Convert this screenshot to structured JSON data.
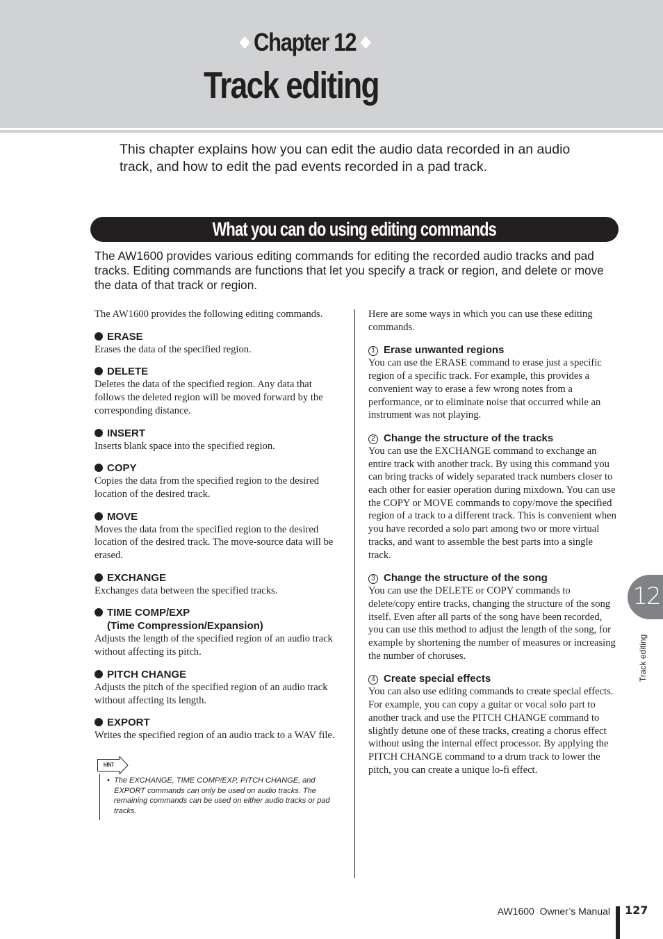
{
  "header": {
    "chapter_label": "Chapter 12",
    "chapter_title": "Track editing",
    "diamond_glyph": "◆"
  },
  "intro": "This chapter explains how you can edit the audio data recorded in an audio track, and how to edit the pad events recorded in a pad track.",
  "section": {
    "title": "What you can do using editing commands",
    "lead": "The AW1600 provides various editing commands for editing the recorded audio tracks and pad tracks. Editing commands are functions that let you specify a track or region, and delete or move the data of that track or region."
  },
  "left_column": {
    "intro": "The AW1600 provides the following editing commands.",
    "commands": [
      {
        "name": "ERASE",
        "subtitle": "",
        "description": "Erases the data of the specified region."
      },
      {
        "name": "DELETE",
        "subtitle": "",
        "description": "Deletes the data of the specified region. Any data that follows the deleted region will be moved forward by the corresponding distance."
      },
      {
        "name": "INSERT",
        "subtitle": "",
        "description": "Inserts blank space into the specified region."
      },
      {
        "name": "COPY",
        "subtitle": "",
        "description": "Copies the data from the specified region to the desired location of the desired track."
      },
      {
        "name": "MOVE",
        "subtitle": "",
        "description": "Moves the data from the specified region to the desired location of the desired track. The move-source data will be erased."
      },
      {
        "name": "EXCHANGE",
        "subtitle": "",
        "description": "Exchanges data between the specified tracks."
      },
      {
        "name": "TIME COMP/EXP",
        "subtitle": "(Time Compression/Expansion)",
        "description": "Adjusts the length of the specified region of an audio track without affecting its pitch."
      },
      {
        "name": "PITCH CHANGE",
        "subtitle": "",
        "description": "Adjusts the pitch of the specified region of an audio track without affecting its length."
      },
      {
        "name": "EXPORT",
        "subtitle": "",
        "description": "Writes the specified region of an audio track to a WAV file."
      }
    ],
    "hint": {
      "label": "HINT",
      "bullet": "•",
      "text": "The EXCHANGE, TIME COMP/EXP, PITCH CHANGE, and EXPORT commands can only be used on audio tracks. The remaining commands can be used on either audio tracks or pad tracks."
    }
  },
  "right_column": {
    "intro": "Here are some ways in which you can use these editing commands.",
    "uses": [
      {
        "number": "1",
        "title": "Erase unwanted regions",
        "text": "You can use the ERASE command to erase just a specific region of a specific track. For example, this provides a convenient way to erase a few wrong notes from a performance, or to eliminate noise that occurred while an instrument was not playing."
      },
      {
        "number": "2",
        "title": "Change the structure of the tracks",
        "text": "You can use the EXCHANGE command to exchange an entire track with another track. By using this command you can bring tracks of widely separated track numbers closer to each other for easier operation during mixdown. You can use the COPY or MOVE commands to copy/move the specified region of a track to a different track. This is convenient when you have recorded a solo part among two or more virtual tracks, and want to assemble the best parts into a single track."
      },
      {
        "number": "3",
        "title": "Change the structure of the song",
        "text": "You can use the DELETE or COPY commands to delete/copy entire tracks, changing the structure of the song itself. Even after all parts of the song have been recorded, you can use this method to adjust the length of the song, for example by shortening the number of measures or increasing the number of choruses."
      },
      {
        "number": "4",
        "title": "Create special effects",
        "text": "You can also use editing commands to create special effects. For example, you can copy a guitar or vocal solo part to another track and use the PITCH CHANGE command to slightly detune one of these tracks, creating a chorus effect without using the internal effect processor. By applying the PITCH CHANGE command to a drum track to lower the pitch, you can create a unique lo-fi effect."
      }
    ]
  },
  "side_tab": {
    "number": "12",
    "label": "Track editing"
  },
  "footer": {
    "manual_name": "AW1600  Owner’s Manual",
    "page_number": "127"
  },
  "colors": {
    "header_gray": "#d1d2d4",
    "text": "#231f20",
    "tab_gray": "#808285"
  }
}
